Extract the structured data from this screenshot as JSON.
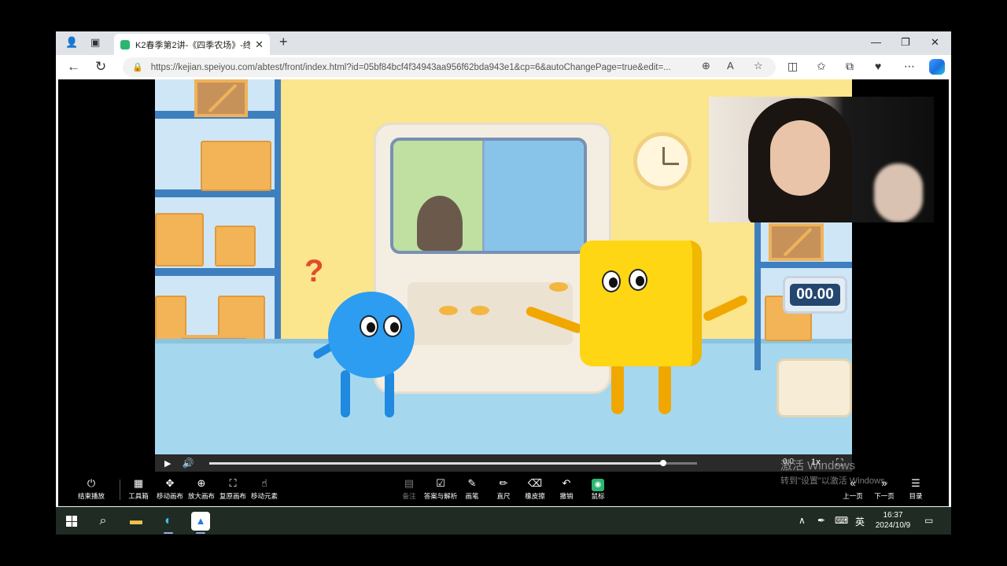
{
  "browser": {
    "tab_title": "K2春季第2讲-《四季农场》-终版",
    "tab_close": "✕",
    "new_tab": "+",
    "url": "https://kejian.speiyou.com/abtest/front/index.html?id=05bf84bcf4f34943aa956f62bda943e1&cp=6&autoChangePage=true&edit=...",
    "win_minimize": "—",
    "win_restore": "❐",
    "win_close": "✕"
  },
  "scene": {
    "timer_text": "00.00",
    "question_mark": "?"
  },
  "video": {
    "progress_fraction": 0.93,
    "time_text": "0:0",
    "speed_text": "1x"
  },
  "toolbar": {
    "end_play": "结束播放",
    "toolbox": "工具箱",
    "move_canvas": "移动画布",
    "zoom_canvas": "放大画布",
    "restore_canvas": "复原画布",
    "move_element": "移动元素",
    "notes": "备注",
    "answer_analysis": "答案与解析",
    "pen": "画笔",
    "ruler": "直尺",
    "eraser": "橡皮擦",
    "undo": "撤销",
    "mouse": "鼠标",
    "prev_page": "上一页",
    "next_page": "下一页",
    "contents": "目录"
  },
  "watermark": {
    "line1": "激活 Windows",
    "line2": "转到\"设置\"以激活 Windows。"
  },
  "taskbar": {
    "ime": "英",
    "time": "16:37",
    "date": "2024/10/9"
  }
}
